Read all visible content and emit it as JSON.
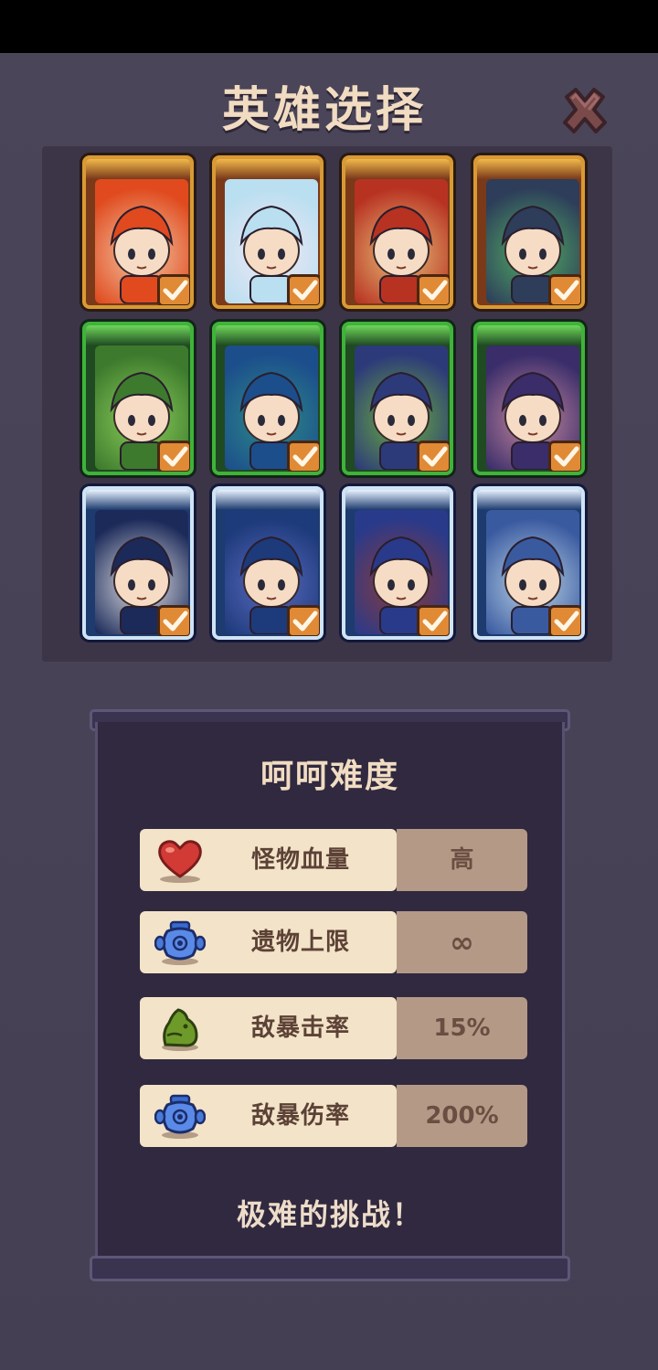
{
  "header": {
    "title": "英雄选择",
    "close_icon": "close-x-icon"
  },
  "heroes": [
    {
      "rarity": "gold",
      "colors": [
        "#e04a1e",
        "#f3c7a5"
      ],
      "selected": true
    },
    {
      "rarity": "gold",
      "colors": [
        "#b9dff0",
        "#f0e7f5"
      ],
      "selected": true
    },
    {
      "rarity": "gold",
      "colors": [
        "#b83222",
        "#e8c27a"
      ],
      "selected": true
    },
    {
      "rarity": "gold",
      "colors": [
        "#2d3d5a",
        "#52b063"
      ],
      "selected": true
    },
    {
      "rarity": "green",
      "colors": [
        "#3d7a2d",
        "#8ccf5a"
      ],
      "selected": true
    },
    {
      "rarity": "green",
      "colors": [
        "#1c4e8c",
        "#2d8c87"
      ],
      "selected": true
    },
    {
      "rarity": "green",
      "colors": [
        "#2d3a7a",
        "#6ab03c"
      ],
      "selected": true
    },
    {
      "rarity": "green",
      "colors": [
        "#3a2d6a",
        "#c98aa0"
      ],
      "selected": true
    },
    {
      "rarity": "blue",
      "colors": [
        "#1c2a5a",
        "#e6e6e6"
      ],
      "selected": true
    },
    {
      "rarity": "blue",
      "colors": [
        "#1d3a7a",
        "#5b6bc0"
      ],
      "selected": true
    },
    {
      "rarity": "blue",
      "colors": [
        "#2a3a8a",
        "#8c3a3a"
      ],
      "selected": true
    },
    {
      "rarity": "blue",
      "colors": [
        "#3a5aa0",
        "#bcd6e8"
      ],
      "selected": true
    }
  ],
  "difficulty": {
    "title": "呵呵难度",
    "stats": [
      {
        "icon": "heart-icon",
        "label": "怪物血量",
        "value": "高"
      },
      {
        "icon": "blue-jar-icon",
        "label": "遗物上限",
        "value": "∞"
      },
      {
        "icon": "green-slime-icon",
        "label": "敌暴击率",
        "value": "15%"
      },
      {
        "icon": "blue-jar-icon",
        "label": "敌暴伤率",
        "value": "200%"
      }
    ],
    "footer": "极难的挑战！"
  }
}
